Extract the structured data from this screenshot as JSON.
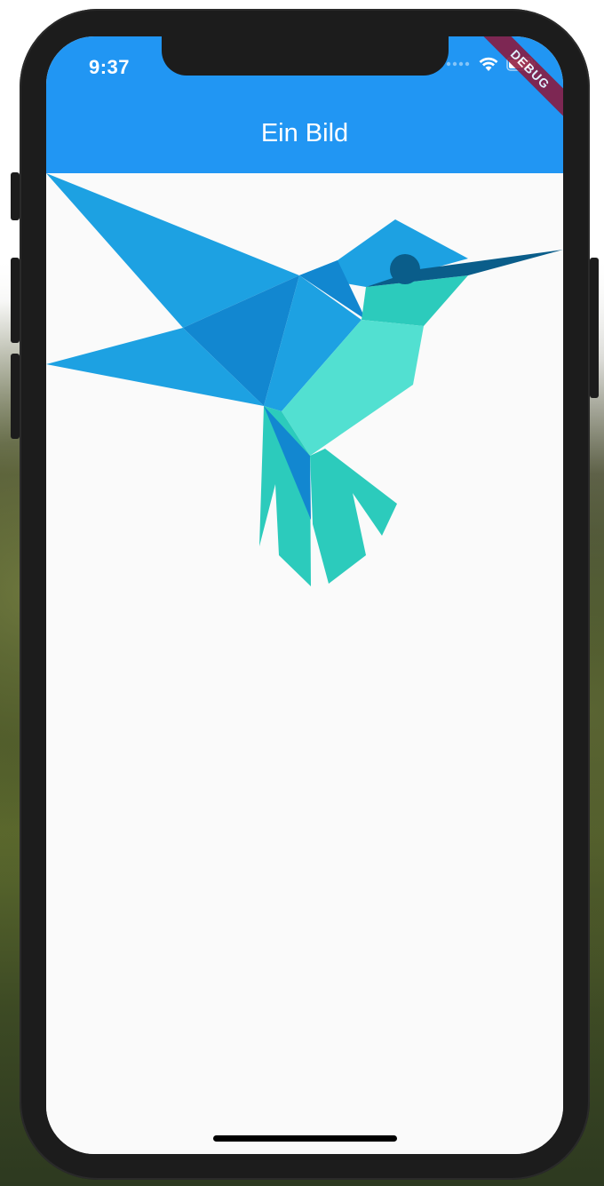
{
  "status_bar": {
    "time": "9:37",
    "icons": [
      "signal-icon",
      "wifi-icon",
      "battery-icon"
    ]
  },
  "app_bar": {
    "title": "Ein Bild",
    "color": "#2196f3"
  },
  "debug_banner": {
    "label": "DEBUG",
    "color": "#8d1437"
  },
  "content": {
    "image": "hummingbird-logo",
    "colors": {
      "wing_blue": "#1da1e2",
      "dark_blue": "#1287d0",
      "teal": "#2ccbbc",
      "light_teal": "#52e0d1",
      "beak": "#0a5d8a"
    }
  },
  "background": {
    "page": "#fafafa",
    "device": "#1c1c1c"
  }
}
